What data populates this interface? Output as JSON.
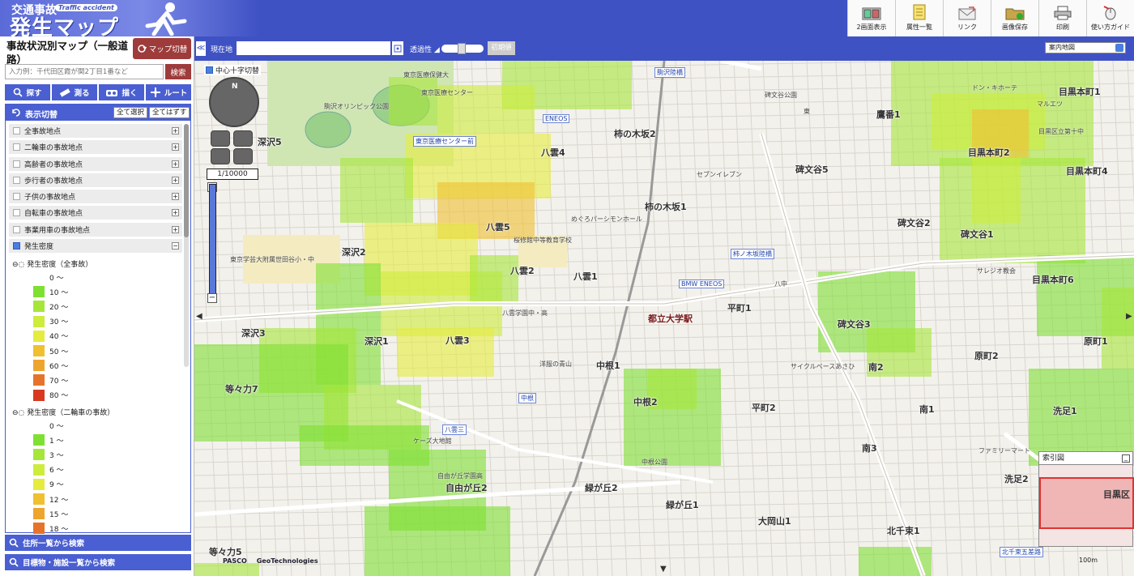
{
  "header": {
    "logo_line1": "交通事故",
    "logo_tag": "Traffic accident",
    "logo_line2": "発生マップ"
  },
  "toolbar": [
    {
      "label": "2画面表示",
      "icon": "dual-screen-icon"
    },
    {
      "label": "属性一覧",
      "icon": "document-list-icon"
    },
    {
      "label": "リンク",
      "icon": "link-envelope-icon"
    },
    {
      "label": "画像保存",
      "icon": "folder-save-icon"
    },
    {
      "label": "印刷",
      "icon": "printer-icon"
    },
    {
      "label": "使い方ガイド",
      "icon": "mouse-guide-icon"
    }
  ],
  "panel": {
    "title": "事故状況別マップ（一般道路）",
    "map_switch_label": "マップ切替",
    "search_placeholder": "入力例：千代田区霞が関2丁目1番など",
    "search_button": "検索",
    "tools": [
      {
        "label": "探す",
        "icon": "search-icon"
      },
      {
        "label": "測る",
        "icon": "ruler-icon"
      },
      {
        "label": "描く",
        "icon": "draw-icon"
      },
      {
        "label": "ルート",
        "icon": "route-icon"
      }
    ],
    "display_title": "表示切替",
    "select_all": "全て選択",
    "deselect_all": "全てはずす",
    "layers": [
      {
        "label": "全事故地点",
        "checked": false
      },
      {
        "label": "二輪車の事故地点",
        "checked": false
      },
      {
        "label": "高齢者の事故地点",
        "checked": false
      },
      {
        "label": "歩行者の事故地点",
        "checked": false
      },
      {
        "label": "子供の事故地点",
        "checked": false
      },
      {
        "label": "自転車の事故地点",
        "checked": false
      },
      {
        "label": "事業用車の事故地点",
        "checked": false
      },
      {
        "label": "発生密度",
        "checked": true
      }
    ],
    "group1": {
      "title": "発生密度（全事故）",
      "legend": [
        {
          "label": "0 〜",
          "color": ""
        },
        {
          "label": "10 〜",
          "color": "#7fe032"
        },
        {
          "label": "20 〜",
          "color": "#a6e63a"
        },
        {
          "label": "30 〜",
          "color": "#cdec3c"
        },
        {
          "label": "40 〜",
          "color": "#e6ec3e"
        },
        {
          "label": "50 〜",
          "color": "#f0c030"
        },
        {
          "label": "60 〜",
          "color": "#eea52e"
        },
        {
          "label": "70 〜",
          "color": "#e7732a"
        },
        {
          "label": "80 〜",
          "color": "#d8391f"
        }
      ]
    },
    "group2": {
      "title": "発生密度（二輪車の事故）",
      "legend": [
        {
          "label": "0 〜",
          "color": ""
        },
        {
          "label": "1 〜",
          "color": "#7fe032"
        },
        {
          "label": "3 〜",
          "color": "#a6e63a"
        },
        {
          "label": "6 〜",
          "color": "#cdec3c"
        },
        {
          "label": "9 〜",
          "color": "#e6ec3e"
        },
        {
          "label": "12 〜",
          "color": "#f0c030"
        },
        {
          "label": "15 〜",
          "color": "#eea52e"
        },
        {
          "label": "18 〜",
          "color": "#e7732a"
        }
      ]
    },
    "bottom_links": [
      "住所一覧から検索",
      "目標物・施設一覧から検索"
    ]
  },
  "maptoolbar": {
    "collapse": "≪",
    "current_location": "現在地",
    "transparency": "透過性",
    "initial_value": "初期値",
    "map_select": "案内地図"
  },
  "map": {
    "crosshair_label": "中心十字切替",
    "scale": "1/10000",
    "overview_title": "索引図",
    "overview_label": "目黒区",
    "scalebar": "100m",
    "credits": [
      "PASCO",
      "GeoTechnologies"
    ],
    "areas": [
      {
        "name": "柿の木坂2"
      },
      {
        "name": "柿の木坂1"
      },
      {
        "name": "八雲4"
      },
      {
        "name": "八雲5"
      },
      {
        "name": "八雲2"
      },
      {
        "name": "八雲1"
      },
      {
        "name": "八雲3"
      },
      {
        "name": "深沢2"
      },
      {
        "name": "深沢3"
      },
      {
        "name": "深沢1"
      },
      {
        "name": "深沢5"
      },
      {
        "name": "等々力7"
      },
      {
        "name": "等々力5"
      },
      {
        "name": "中根1"
      },
      {
        "name": "中根2"
      },
      {
        "name": "平町1"
      },
      {
        "name": "平町2"
      },
      {
        "name": "碑文谷5"
      },
      {
        "name": "碑文谷2"
      },
      {
        "name": "碑文谷1"
      },
      {
        "name": "碑文谷3"
      },
      {
        "name": "南2"
      },
      {
        "name": "南1"
      },
      {
        "name": "南3"
      },
      {
        "name": "原町2"
      },
      {
        "name": "原町1"
      },
      {
        "name": "目黒本町1"
      },
      {
        "name": "目黒本町2"
      },
      {
        "name": "目黒本町4"
      },
      {
        "name": "目黒本町6"
      },
      {
        "name": "鷹番1"
      },
      {
        "name": "洗足1"
      },
      {
        "name": "洗足2"
      },
      {
        "name": "緑が丘2"
      },
      {
        "name": "緑が丘1"
      },
      {
        "name": "大岡山1"
      },
      {
        "name": "北千束1"
      },
      {
        "name": "自由が丘2"
      },
      {
        "name": "都立大学駅"
      }
    ],
    "road_labels": [
      "駒沢陸橋",
      "東京医療センター前",
      "柿ノ木坂陸橋",
      "八雲三",
      "中根",
      "北千束五差路",
      "ENEOS",
      "BMW ENEOS"
    ],
    "small_labels": [
      "東京医療保健大",
      "東京医療センター",
      "駒沢オリンピック公園",
      "めぐろパーシモンホール",
      "桜修館中等教育学校",
      "東京学芸大附属世田谷小・中",
      "八雲学園中・高",
      "洋服の青山",
      "中根公園",
      "ケーズ大地館",
      "自由が丘学園高",
      "サイクルベースあさひ",
      "セブンイレブン",
      "ファミリーマート",
      "サレジオ教会",
      "碑文谷公園",
      "八中",
      "東",
      "セブンイレブン",
      "マルエツ",
      "ドン・キホーテ",
      "目黒区立第十中"
    ]
  }
}
